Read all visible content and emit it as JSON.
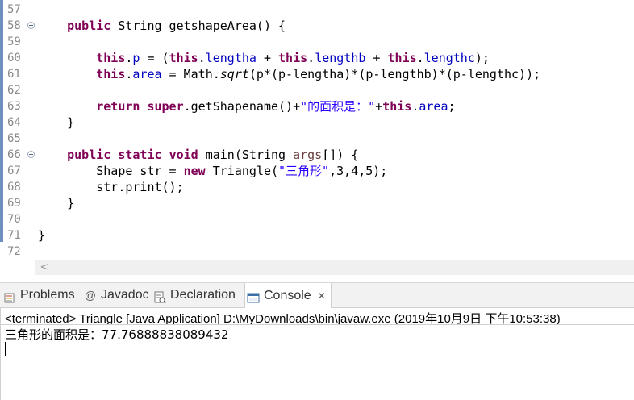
{
  "editor": {
    "lines": [
      {
        "num": "57",
        "fold": false,
        "text": ""
      },
      {
        "num": "58",
        "fold": true,
        "text": "    public String getshapeArea() {"
      },
      {
        "num": "59",
        "fold": false,
        "text": ""
      },
      {
        "num": "60",
        "fold": false,
        "text": "        this.p = (this.lengtha + this.lengthb + this.lengthc);"
      },
      {
        "num": "61",
        "fold": false,
        "text": "        this.area = Math.sqrt(p*(p-lengtha)*(p-lengthb)*(p-lengthc));"
      },
      {
        "num": "62",
        "fold": false,
        "text": ""
      },
      {
        "num": "63",
        "fold": false,
        "text": "        return super.getShapename()+\"的面积是：\"+this.area;"
      },
      {
        "num": "64",
        "fold": false,
        "text": "    }"
      },
      {
        "num": "65",
        "fold": false,
        "text": ""
      },
      {
        "num": "66",
        "fold": true,
        "text": "    public static void main(String args[]) {"
      },
      {
        "num": "67",
        "fold": false,
        "text": "        Shape str = new Triangle(\"三角形\",3,4,5);"
      },
      {
        "num": "68",
        "fold": false,
        "text": "        str.print();"
      },
      {
        "num": "69",
        "fold": false,
        "text": "    }"
      },
      {
        "num": "70",
        "fold": false,
        "text": ""
      },
      {
        "num": "71",
        "fold": false,
        "text": "}"
      },
      {
        "num": "72",
        "fold": false,
        "text": ""
      }
    ],
    "scroll_left_glyph": "<"
  },
  "tabs": {
    "problems": "Problems",
    "javadoc": "Javadoc",
    "declaration": "Declaration",
    "console": "Console",
    "close_glyph": "✕",
    "javadoc_icon_glyph": "@"
  },
  "console": {
    "header": "<terminated> Triangle [Java Application] D:\\MyDownloads\\bin\\javaw.exe (2019年10月9日 下午10:53:38)",
    "output": "三角形的面积是：77.76888838089432"
  },
  "colors": {
    "keyword": "#7f0055",
    "field": "#0000c0",
    "string": "#2a00ff",
    "ruler": "#6e8fbf"
  }
}
